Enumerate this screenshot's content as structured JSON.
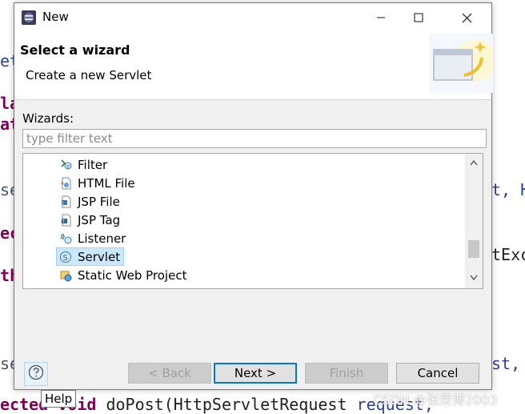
{
  "editor": {
    "lines": [
      {
        "text": "et",
        "cls": "pm"
      },
      {
        "text": "la",
        "cls": "kw"
      },
      {
        "text": "at",
        "cls": "kw"
      },
      {
        "text": "se",
        "cls": "dim"
      },
      {
        "text": "ec",
        "cls": "kw"
      },
      {
        "text": "th",
        "cls": "kw"
      },
      {
        "text": "se",
        "cls": "dim"
      }
    ],
    "right_fragments": [
      "t, H",
      "tExc",
      "st,"
    ],
    "bottom_line": {
      "kw": "ected void",
      "rest": " doPost(HttpServletRequest ",
      "param": "request,"
    }
  },
  "dialog": {
    "title": "New",
    "header_title": "Select a wizard",
    "header_desc": "Create a new Servlet",
    "wizards_label": "Wizards:",
    "filter_placeholder": "type filter text",
    "filter_value": "",
    "items": [
      {
        "label": "Filter",
        "icon": "filter-icon"
      },
      {
        "label": "HTML File",
        "icon": "html-file-icon"
      },
      {
        "label": "JSP File",
        "icon": "jsp-file-icon"
      },
      {
        "label": "JSP Tag",
        "icon": "jsp-tag-icon"
      },
      {
        "label": "Listener",
        "icon": "listener-icon"
      },
      {
        "label": "Servlet",
        "icon": "servlet-icon",
        "selected": true
      },
      {
        "label": "Static Web Project",
        "icon": "static-web-project-icon"
      }
    ],
    "buttons": {
      "back": "< Back",
      "next": "Next >",
      "finish": "Finish",
      "cancel": "Cancel"
    },
    "help_tooltip": "Help",
    "window_controls": {
      "minimize": "minimize-icon",
      "maximize": "maximize-icon",
      "close": "close-icon"
    }
  },
  "watermark": "CSDN @张荣博2003"
}
